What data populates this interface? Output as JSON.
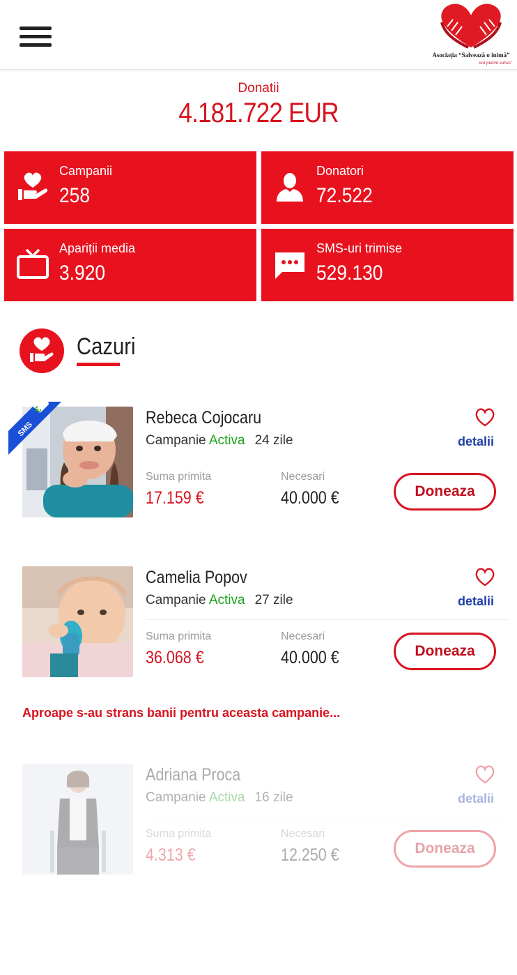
{
  "header": {
    "menu_icon": "hamburger-menu-icon",
    "logo_name": "Asociația “Salvează o inimă”",
    "logo_slogan": "noi putem salva!"
  },
  "totals": {
    "label": "Donatii",
    "value": "4.181.722 EUR"
  },
  "stats": [
    {
      "label": "Campanii",
      "value": "258",
      "icon": "heart-hand-icon"
    },
    {
      "label": "Donatori",
      "value": "72.522",
      "icon": "person-icon"
    },
    {
      "label": "Apariții media",
      "value": "3.920",
      "icon": "tv-icon"
    },
    {
      "label": "SMS-uri trimise",
      "value": "529.130",
      "icon": "message-icon"
    }
  ],
  "section": {
    "title": "Cazuri",
    "icon": "heart-hand-icon"
  },
  "labels": {
    "status_prefix": "Campanie",
    "status_active": "Activa",
    "received": "Suma primita",
    "needed": "Necesari",
    "details": "detalii",
    "donate": "Doneaza",
    "sms_badge": "SMS",
    "euro_symbol": "€"
  },
  "cases": [
    {
      "name": "Rebeca Cojocaru",
      "days": "24 zile",
      "received": "17.159 €",
      "needed": "40.000 €",
      "sms": true
    },
    {
      "name": "Camelia Popov",
      "days": "27 zile",
      "received": "36.068 €",
      "needed": "40.000 €",
      "sms": false
    },
    {
      "name": "Adriana Proca",
      "days": "16 zile",
      "received": "4.313 €",
      "needed": "12.250 €",
      "sms": false
    }
  ],
  "notice": "Aproape s-au strans banii pentru aceasta campanie...",
  "colors": {
    "brand_red": "#e8121f",
    "active_green": "#1aa01a",
    "link_blue": "#1f3fa6",
    "ribbon_blue": "#1a4fd8"
  }
}
